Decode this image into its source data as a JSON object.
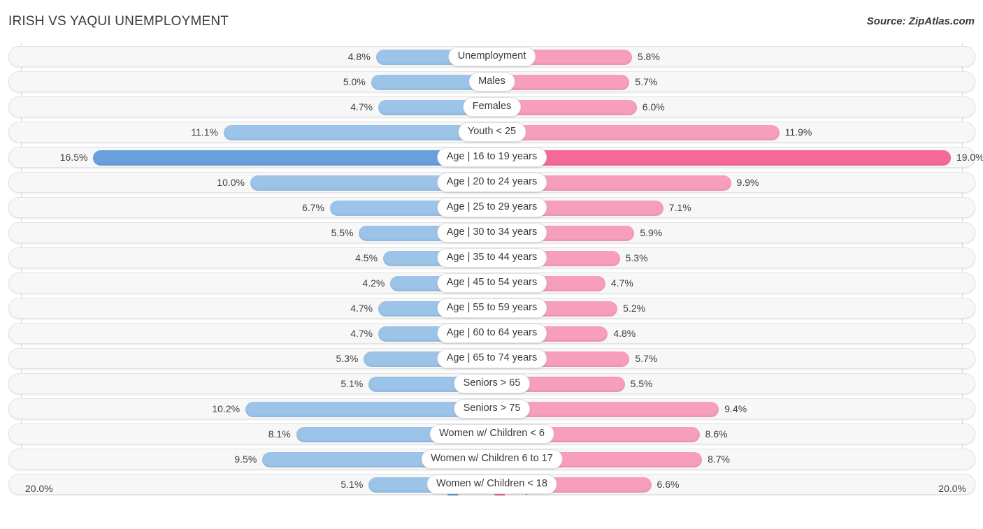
{
  "header": {
    "title": "IRISH VS YAQUI UNEMPLOYMENT",
    "source": "Source: ZipAtlas.com"
  },
  "axis": {
    "left_label": "20.0%",
    "right_label": "20.0%",
    "max": 20.0
  },
  "legend": {
    "items": [
      {
        "label": "Irish",
        "color": "#5b9bd5"
      },
      {
        "label": "Yaqui",
        "color": "#ef5f92"
      }
    ]
  },
  "colors": {
    "irish": "#9cc3e8",
    "irish_highlight": "#6a9fdd",
    "yaqui": "#f79ebc",
    "yaqui_highlight": "#f4689a",
    "track": "#f7f7f7"
  },
  "chart_data": {
    "type": "bar",
    "title": "IRISH VS YAQUI UNEMPLOYMENT",
    "subtitle": "Source: ZipAtlas.com",
    "orientation": "horizontal-diverging",
    "xlabel": "",
    "ylabel": "",
    "xlim": [
      20.0,
      20.0
    ],
    "grid": true,
    "legend_position": "bottom-center",
    "categories": [
      "Unemployment",
      "Males",
      "Females",
      "Youth < 25",
      "Age | 16 to 19 years",
      "Age | 20 to 24 years",
      "Age | 25 to 29 years",
      "Age | 30 to 34 years",
      "Age | 35 to 44 years",
      "Age | 45 to 54 years",
      "Age | 55 to 59 years",
      "Age | 60 to 64 years",
      "Age | 65 to 74 years",
      "Seniors > 65",
      "Seniors > 75",
      "Women w/ Children < 6",
      "Women w/ Children 6 to 17",
      "Women w/ Children < 18"
    ],
    "series": [
      {
        "name": "Irish",
        "color": "#9cc3e8",
        "values": [
          4.8,
          5.0,
          4.7,
          11.1,
          16.5,
          10.0,
          6.7,
          5.5,
          4.5,
          4.2,
          4.7,
          4.7,
          5.3,
          5.1,
          10.2,
          8.1,
          9.5,
          5.1
        ]
      },
      {
        "name": "Yaqui",
        "color": "#f79ebc",
        "values": [
          5.8,
          5.7,
          6.0,
          11.9,
          19.0,
          9.9,
          7.1,
          5.9,
          5.3,
          4.7,
          5.2,
          4.8,
          5.7,
          5.5,
          9.4,
          8.6,
          8.7,
          6.6
        ]
      }
    ],
    "highlighted_category": "Age | 16 to 19 years"
  },
  "rows": [
    {
      "label": "Unemployment",
      "left": "4.8%",
      "right": "5.8%",
      "lv": 4.8,
      "rv": 5.8,
      "hl": false
    },
    {
      "label": "Males",
      "left": "5.0%",
      "right": "5.7%",
      "lv": 5.0,
      "rv": 5.7,
      "hl": false
    },
    {
      "label": "Females",
      "left": "4.7%",
      "right": "6.0%",
      "lv": 4.7,
      "rv": 6.0,
      "hl": false
    },
    {
      "label": "Youth < 25",
      "left": "11.1%",
      "right": "11.9%",
      "lv": 11.1,
      "rv": 11.9,
      "hl": false
    },
    {
      "label": "Age | 16 to 19 years",
      "left": "16.5%",
      "right": "19.0%",
      "lv": 16.5,
      "rv": 19.0,
      "hl": true
    },
    {
      "label": "Age | 20 to 24 years",
      "left": "10.0%",
      "right": "9.9%",
      "lv": 10.0,
      "rv": 9.9,
      "hl": false
    },
    {
      "label": "Age | 25 to 29 years",
      "left": "6.7%",
      "right": "7.1%",
      "lv": 6.7,
      "rv": 7.1,
      "hl": false
    },
    {
      "label": "Age | 30 to 34 years",
      "left": "5.5%",
      "right": "5.9%",
      "lv": 5.5,
      "rv": 5.9,
      "hl": false
    },
    {
      "label": "Age | 35 to 44 years",
      "left": "4.5%",
      "right": "5.3%",
      "lv": 4.5,
      "rv": 5.3,
      "hl": false
    },
    {
      "label": "Age | 45 to 54 years",
      "left": "4.2%",
      "right": "4.7%",
      "lv": 4.2,
      "rv": 4.7,
      "hl": false
    },
    {
      "label": "Age | 55 to 59 years",
      "left": "4.7%",
      "right": "5.2%",
      "lv": 4.7,
      "rv": 5.2,
      "hl": false
    },
    {
      "label": "Age | 60 to 64 years",
      "left": "4.7%",
      "right": "4.8%",
      "lv": 4.7,
      "rv": 4.8,
      "hl": false
    },
    {
      "label": "Age | 65 to 74 years",
      "left": "5.3%",
      "right": "5.7%",
      "lv": 5.3,
      "rv": 5.7,
      "hl": false
    },
    {
      "label": "Seniors > 65",
      "left": "5.1%",
      "right": "5.5%",
      "lv": 5.1,
      "rv": 5.5,
      "hl": false
    },
    {
      "label": "Seniors > 75",
      "left": "10.2%",
      "right": "9.4%",
      "lv": 10.2,
      "rv": 9.4,
      "hl": false
    },
    {
      "label": "Women w/ Children < 6",
      "left": "8.1%",
      "right": "8.6%",
      "lv": 8.1,
      "rv": 8.6,
      "hl": false
    },
    {
      "label": "Women w/ Children 6 to 17",
      "left": "9.5%",
      "right": "8.7%",
      "lv": 9.5,
      "rv": 8.7,
      "hl": false
    },
    {
      "label": "Women w/ Children < 18",
      "left": "5.1%",
      "right": "6.6%",
      "lv": 5.1,
      "rv": 6.6,
      "hl": false
    }
  ]
}
